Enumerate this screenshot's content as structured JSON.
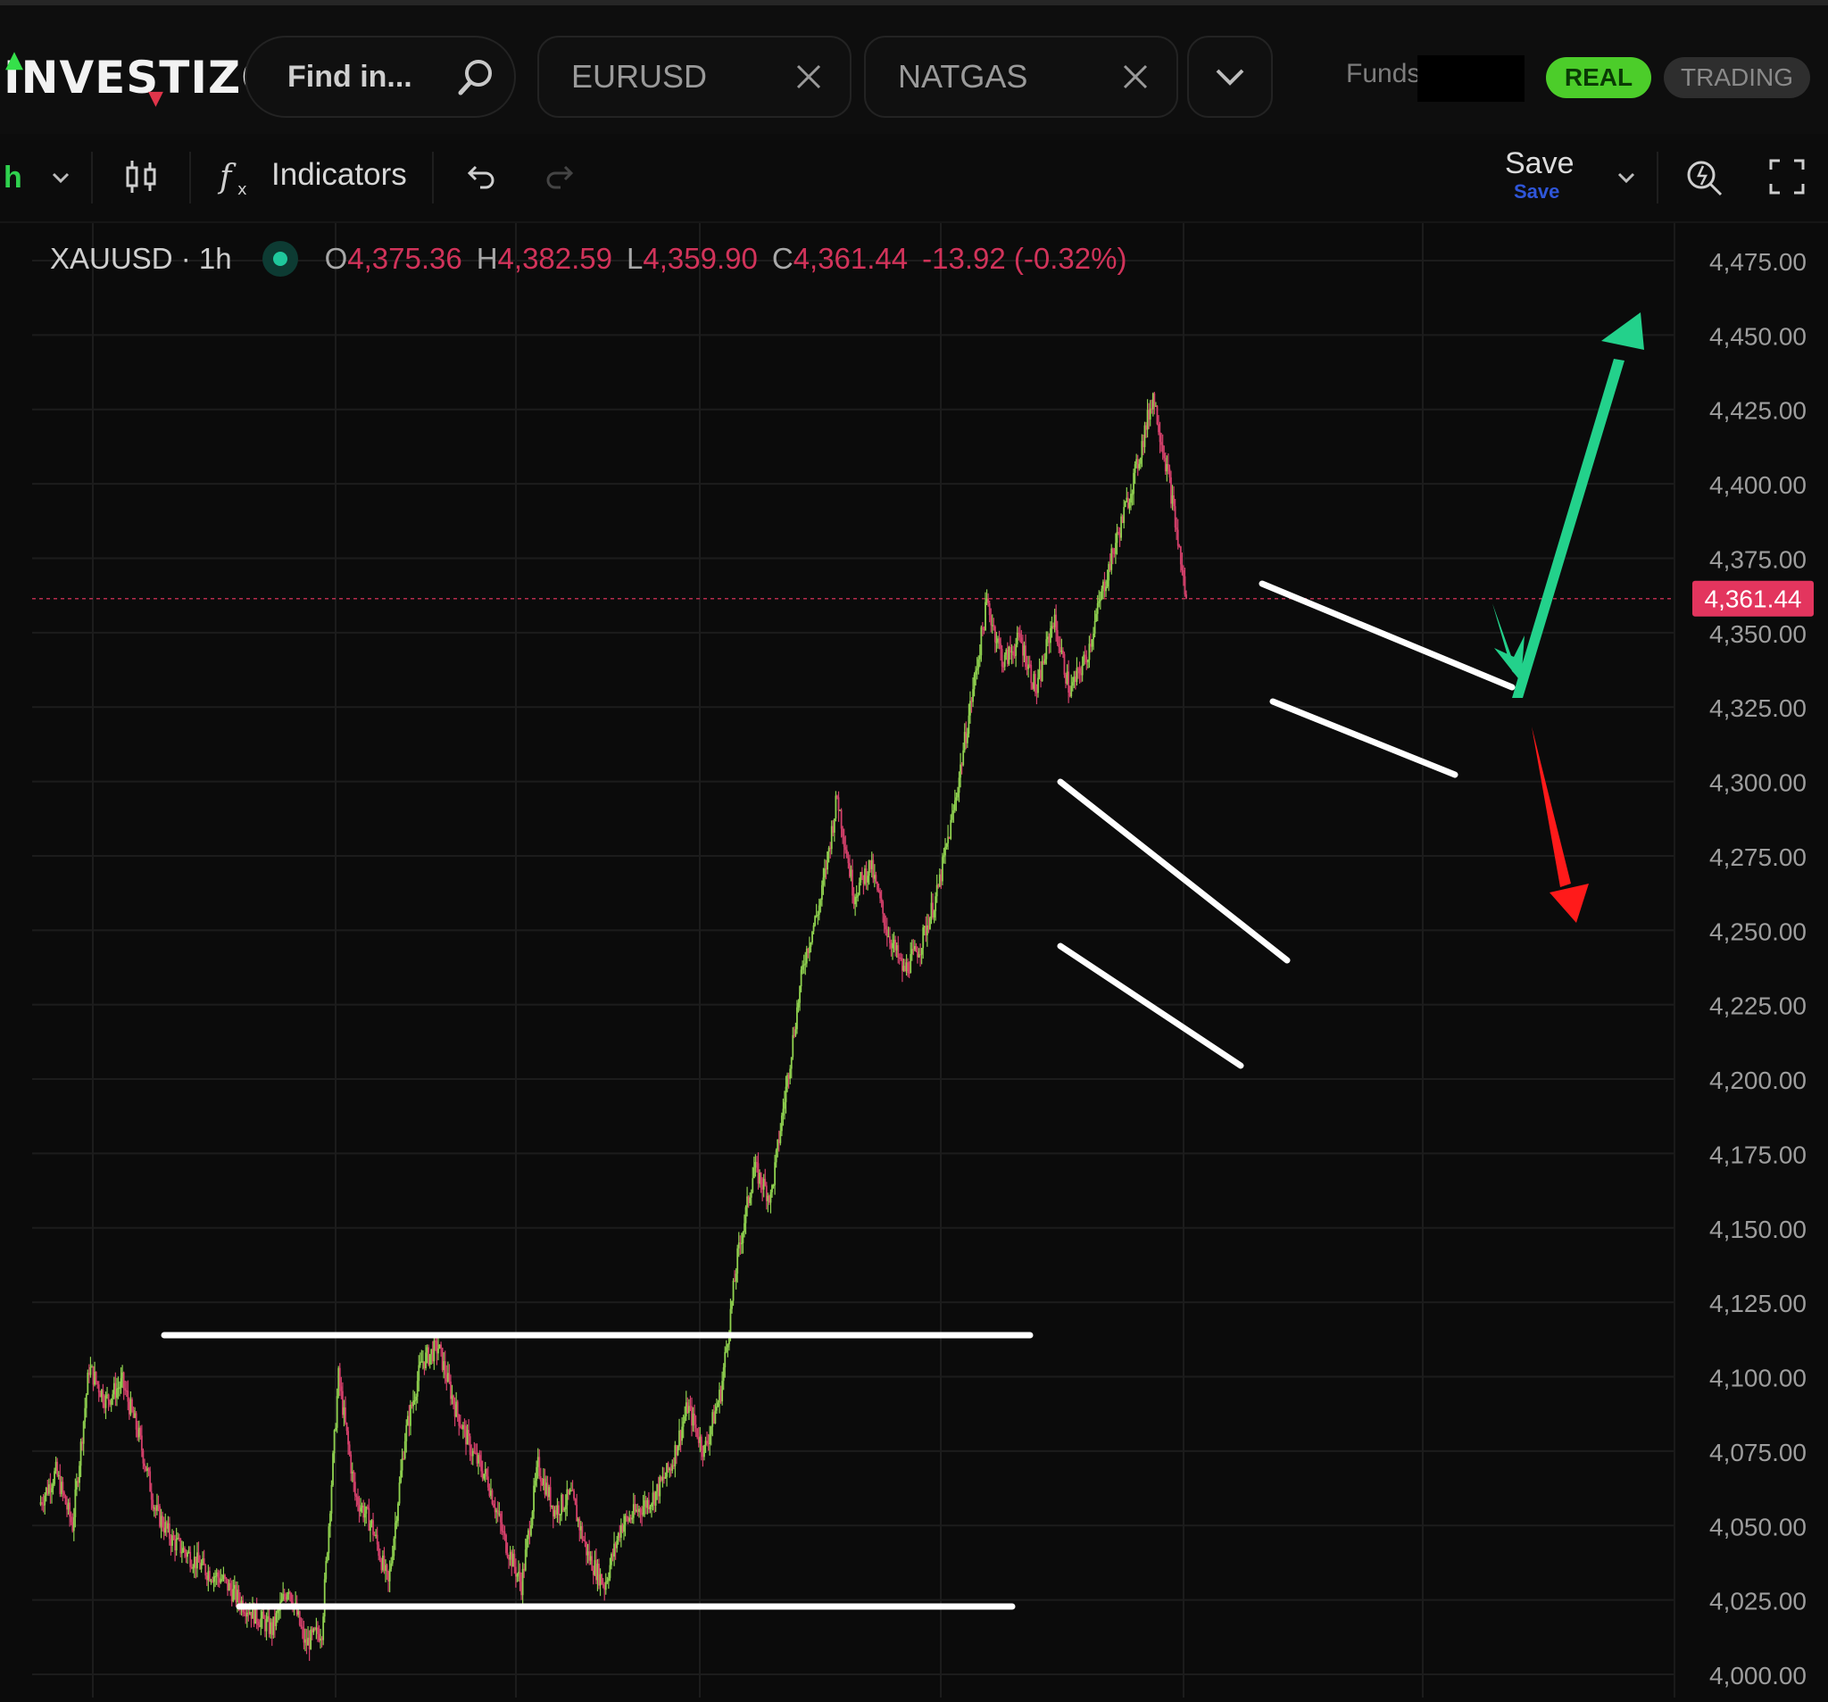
{
  "header": {
    "logo": "INVESTIZO",
    "search_placeholder": "Find in...",
    "tabs": [
      {
        "label": "EURUSD"
      },
      {
        "label": "NATGAS"
      }
    ],
    "funds_label": "Funds:",
    "mode_real": "REAL",
    "mode_trading": "TRADING"
  },
  "toolbar": {
    "interval": "h",
    "indicators_label": "Indicators",
    "save_label": "Save",
    "save_sublabel": "Save"
  },
  "legend": {
    "symbol": "XAUUSD · 1h",
    "o_key": "O",
    "o_val": "4,375.36",
    "h_key": "H",
    "h_val": "4,382.59",
    "l_key": "L",
    "l_val": "4,359.90",
    "c_key": "C",
    "c_val": "4,361.44",
    "change": "-13.92 (-0.32%)"
  },
  "colors": {
    "up": "#8fd14f",
    "down": "#d4406b",
    "accent_green": "#23d18b",
    "arrow_red": "#ff1a1a",
    "price_tag": "#e3355e",
    "background": "#0b0b0b"
  },
  "chart_data": {
    "type": "candlestick",
    "symbol": "XAUUSD",
    "interval": "1h",
    "ylim": [
      4000,
      4475
    ],
    "y_ticks": [
      "4,475.00",
      "4,450.00",
      "4,425.00",
      "4,400.00",
      "4,375.00",
      "4,350.00",
      "4,325.00",
      "4,300.00",
      "4,275.00",
      "4,250.00",
      "4,225.00",
      "4,200.00",
      "4,175.00",
      "4,150.00",
      "4,125.00",
      "4,100.00",
      "4,075.00",
      "4,050.00",
      "4,025.00",
      "4,000.00"
    ],
    "last_price": 4361.44,
    "last_price_label": "4,361.44",
    "grid": true,
    "path_points": [
      [
        0,
        4057
      ],
      [
        12,
        4068
      ],
      [
        24,
        4050
      ],
      [
        36,
        4103
      ],
      [
        48,
        4092
      ],
      [
        60,
        4098
      ],
      [
        72,
        4080
      ],
      [
        84,
        4055
      ],
      [
        96,
        4045
      ],
      [
        108,
        4040
      ],
      [
        120,
        4035
      ],
      [
        132,
        4032
      ],
      [
        144,
        4025
      ],
      [
        156,
        4020
      ],
      [
        168,
        4015
      ],
      [
        180,
        4030
      ],
      [
        192,
        4010
      ],
      [
        204,
        4015
      ],
      [
        216,
        4100
      ],
      [
        228,
        4060
      ],
      [
        240,
        4050
      ],
      [
        252,
        4030
      ],
      [
        264,
        4080
      ],
      [
        276,
        4105
      ],
      [
        288,
        4110
      ],
      [
        300,
        4090
      ],
      [
        312,
        4075
      ],
      [
        324,
        4065
      ],
      [
        336,
        4045
      ],
      [
        348,
        4030
      ],
      [
        360,
        4070
      ],
      [
        372,
        4055
      ],
      [
        384,
        4060
      ],
      [
        396,
        4040
      ],
      [
        408,
        4030
      ],
      [
        420,
        4050
      ],
      [
        432,
        4055
      ],
      [
        444,
        4060
      ],
      [
        456,
        4070
      ],
      [
        468,
        4090
      ],
      [
        480,
        4075
      ],
      [
        492,
        4095
      ],
      [
        504,
        4140
      ],
      [
        516,
        4170
      ],
      [
        528,
        4160
      ],
      [
        540,
        4200
      ],
      [
        552,
        4240
      ],
      [
        564,
        4260
      ],
      [
        576,
        4295
      ],
      [
        588,
        4262
      ],
      [
        600,
        4272
      ],
      [
        612,
        4250
      ],
      [
        624,
        4236
      ],
      [
        636,
        4245
      ],
      [
        648,
        4262
      ],
      [
        660,
        4290
      ],
      [
        672,
        4325
      ],
      [
        684,
        4360
      ],
      [
        696,
        4340
      ],
      [
        708,
        4348
      ],
      [
        720,
        4330
      ],
      [
        732,
        4355
      ],
      [
        744,
        4330
      ],
      [
        756,
        4342
      ],
      [
        768,
        4365
      ],
      [
        780,
        4385
      ],
      [
        792,
        4405
      ],
      [
        804,
        4430
      ],
      [
        816,
        4400
      ],
      [
        828,
        4361
      ]
    ],
    "annotations": [
      {
        "kind": "horizontal_line",
        "price": 4113,
        "desc": "range resistance"
      },
      {
        "kind": "horizontal_line",
        "price": 4021,
        "desc": "range support"
      },
      {
        "kind": "channel",
        "desc": "descending flag 1"
      },
      {
        "kind": "channel",
        "desc": "descending flag 2"
      },
      {
        "kind": "arrow",
        "direction": "up",
        "color": "green"
      },
      {
        "kind": "arrow",
        "direction": "down",
        "color": "red"
      }
    ]
  }
}
